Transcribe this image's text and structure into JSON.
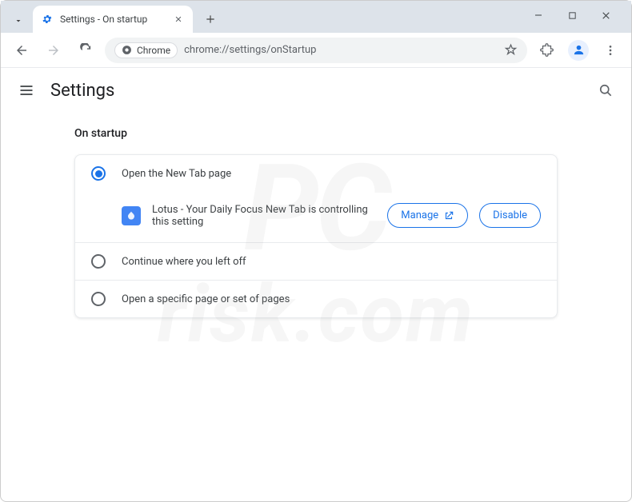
{
  "window": {
    "tab_title": "Settings - On startup",
    "omnibox_chip": "Chrome",
    "url": "chrome://settings/onStartup"
  },
  "settings": {
    "title": "Settings",
    "section": "On startup",
    "options": [
      {
        "label": "Open the New Tab page",
        "selected": true
      },
      {
        "label": "Continue where you left off",
        "selected": false
      },
      {
        "label": "Open a specific page or set of pages",
        "selected": false
      }
    ],
    "extension_notice": "Lotus - Your Daily Focus New Tab is controlling this setting",
    "manage_label": "Manage",
    "disable_label": "Disable"
  },
  "watermark": {
    "line1": "PC",
    "line2": "risk.com"
  }
}
